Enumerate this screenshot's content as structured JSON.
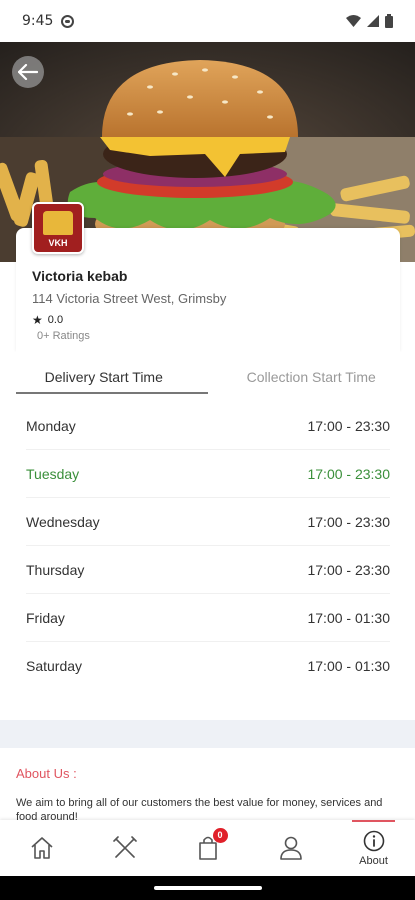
{
  "status_bar": {
    "time": "9:45"
  },
  "hero": {
    "image_subject": "burger-with-fries"
  },
  "restaurant": {
    "logo_text": "VKH",
    "name": "Victoria kebab",
    "address": "114 Victoria Street West, Grimsby",
    "rating": "0.0",
    "ratings_count": "0+ Ratings"
  },
  "tabs": [
    {
      "label": "Delivery Start Time",
      "active": true
    },
    {
      "label": "Collection Start Time",
      "active": false
    }
  ],
  "schedule": [
    {
      "day": "Monday",
      "hours": "17:00 - 23:30"
    },
    {
      "day": "Tuesday",
      "hours": "17:00 - 23:30",
      "today": true
    },
    {
      "day": "Wednesday",
      "hours": "17:00 - 23:30"
    },
    {
      "day": "Thursday",
      "hours": "17:00 - 23:30"
    },
    {
      "day": "Friday",
      "hours": "17:00 - 01:30"
    },
    {
      "day": "Saturday",
      "hours": "17:00 - 01:30"
    }
  ],
  "about": {
    "title": "About Us :",
    "text": "We aim to bring all of our customers the best value for money, services and food around!"
  },
  "nav": {
    "items": [
      {
        "icon": "home-icon"
      },
      {
        "icon": "fork-knife-icon"
      },
      {
        "icon": "shopping-bag-icon",
        "badge": "0"
      },
      {
        "icon": "user-icon"
      },
      {
        "icon": "info-icon",
        "label": "About",
        "active": true
      }
    ]
  },
  "colors": {
    "accent": "#e05560",
    "today": "#3a8f3a",
    "badge": "#e0202a"
  }
}
